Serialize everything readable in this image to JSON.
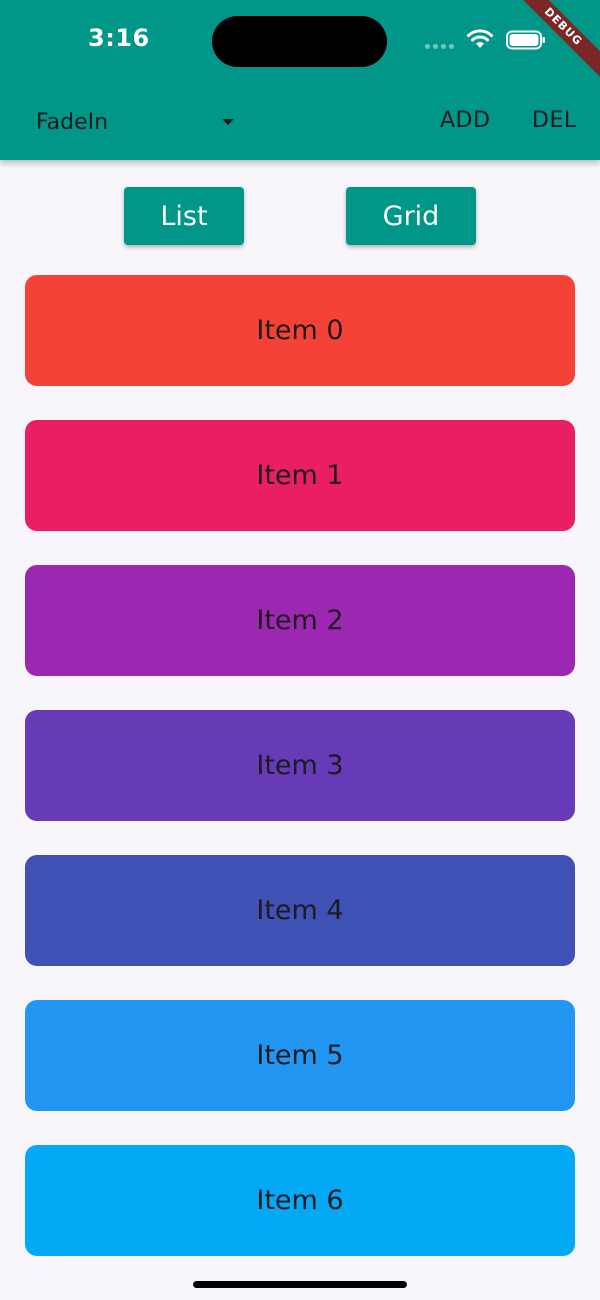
{
  "status_bar": {
    "time": "3:16"
  },
  "debug_banner": "DEBUG",
  "appbar": {
    "dropdown_value": "FadeIn",
    "add_label": "ADD",
    "del_label": "DEL",
    "color": "#009688"
  },
  "layout_buttons": {
    "list_label": "List",
    "grid_label": "Grid"
  },
  "items": [
    {
      "label": "Item 0",
      "color": "#f44336"
    },
    {
      "label": "Item 1",
      "color": "#e91e63"
    },
    {
      "label": "Item 2",
      "color": "#9c27b0"
    },
    {
      "label": "Item 3",
      "color": "#673ab7"
    },
    {
      "label": "Item 4",
      "color": "#3f51b5"
    },
    {
      "label": "Item 5",
      "color": "#2196f3"
    },
    {
      "label": "Item 6",
      "color": "#03a9f4"
    }
  ]
}
